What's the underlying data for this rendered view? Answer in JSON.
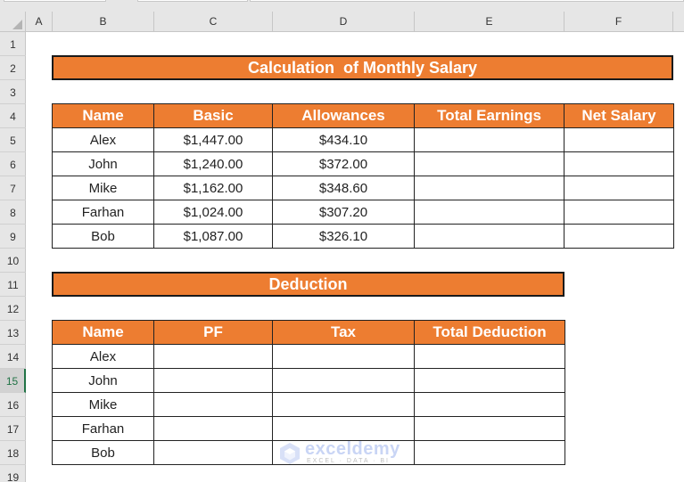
{
  "colors": {
    "accent_orange": "#ED7D31",
    "header_gray": "#E6E6E6",
    "selection_green": "#217346"
  },
  "spreadsheet": {
    "columns": [
      "A",
      "B",
      "C",
      "D",
      "E",
      "F"
    ],
    "rows": [
      "1",
      "2",
      "3",
      "4",
      "5",
      "6",
      "7",
      "8",
      "9",
      "10",
      "11",
      "12",
      "13",
      "14",
      "15",
      "16",
      "17",
      "18",
      "19"
    ],
    "selected_row": "15"
  },
  "salary_section": {
    "title": "Calculation  of Monthly Salary",
    "headers": [
      "Name",
      "Basic",
      "Allowances",
      "Total Earnings",
      "Net Salary"
    ],
    "rows": [
      {
        "name": "Alex",
        "basic": "$1,447.00",
        "allowances": "$434.10",
        "total_earnings": "",
        "net_salary": ""
      },
      {
        "name": "John",
        "basic": "$1,240.00",
        "allowances": "$372.00",
        "total_earnings": "",
        "net_salary": ""
      },
      {
        "name": "Mike",
        "basic": "$1,162.00",
        "allowances": "$348.60",
        "total_earnings": "",
        "net_salary": ""
      },
      {
        "name": "Farhan",
        "basic": "$1,024.00",
        "allowances": "$307.20",
        "total_earnings": "",
        "net_salary": ""
      },
      {
        "name": "Bob",
        "basic": "$1,087.00",
        "allowances": "$326.10",
        "total_earnings": "",
        "net_salary": ""
      }
    ]
  },
  "deduction_section": {
    "title": "Deduction",
    "headers": [
      "Name",
      "PF",
      "Tax",
      "Total Deduction"
    ],
    "rows": [
      {
        "name": "Alex",
        "pf": "",
        "tax": "",
        "total_deduction": ""
      },
      {
        "name": "John",
        "pf": "",
        "tax": "",
        "total_deduction": ""
      },
      {
        "name": "Mike",
        "pf": "",
        "tax": "",
        "total_deduction": ""
      },
      {
        "name": "Farhan",
        "pf": "",
        "tax": "",
        "total_deduction": ""
      },
      {
        "name": "Bob",
        "pf": "",
        "tax": "",
        "total_deduction": ""
      }
    ]
  },
  "watermark": {
    "brand": "exceldemy",
    "tagline": "EXCEL · DATA · BI",
    "icon": "exceldemy-logo-icon"
  }
}
